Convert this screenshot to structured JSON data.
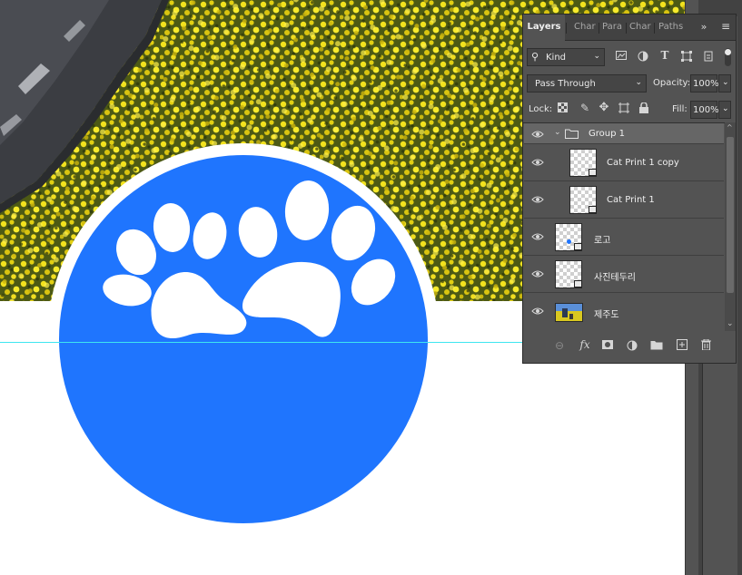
{
  "panel": {
    "tabs": [
      "Layers",
      "Char",
      "Para",
      "Char",
      "Paths"
    ],
    "active_tab": "Layers",
    "filter_kind": "Kind",
    "blend_mode": "Pass Through",
    "opacity_label": "Opacity:",
    "opacity_value": "100%",
    "lock_label": "Lock:",
    "fill_label": "Fill:",
    "fill_value": "100%",
    "layers": [
      {
        "name": "Group 1",
        "type": "group",
        "visible": true,
        "selected": true
      },
      {
        "name": "Cat Print 1 copy",
        "type": "smart-object",
        "visible": true
      },
      {
        "name": "Cat Print 1",
        "type": "smart-object",
        "visible": true
      },
      {
        "name": "로고",
        "type": "smart-object",
        "visible": true
      },
      {
        "name": "사진테두리",
        "type": "smart-object",
        "visible": true
      },
      {
        "name": "제주도",
        "type": "photo",
        "visible": true
      }
    ]
  },
  "canvas": {
    "logo_color": "#1f75fe",
    "guide_color": "#3ee6f0",
    "flower_color": "#e8d61a"
  }
}
